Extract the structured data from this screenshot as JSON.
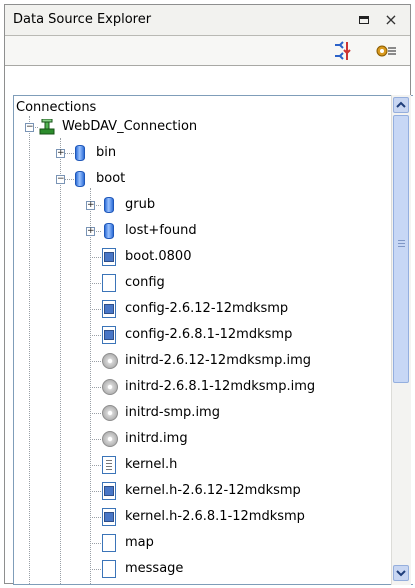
{
  "window": {
    "title": "Data Source Explorer",
    "maximize_symbol": "□",
    "close_symbol": "×"
  },
  "toolbar": {
    "collapse_icon": "collapse-all-icon",
    "menu_icon": "view-menu-icon"
  },
  "tree": {
    "root_label": "Connections",
    "connection_label": "WebDAV_Connection",
    "folders": [
      {
        "label": "bin",
        "icon": "database-icon"
      },
      {
        "label": "boot",
        "icon": "database-icon"
      },
      {
        "label": "grub",
        "icon": "database-icon"
      },
      {
        "label": "lost+found",
        "icon": "database-icon"
      }
    ],
    "files": [
      {
        "label": "boot.0800",
        "icon": "window-file-icon"
      },
      {
        "label": "config",
        "icon": "blank-file-icon"
      },
      {
        "label": "config-2.6.12-12mdksmp",
        "icon": "window-file-icon"
      },
      {
        "label": "config-2.6.8.1-12mdksmp",
        "icon": "window-file-icon"
      },
      {
        "label": "initrd-2.6.12-12mdksmp.img",
        "icon": "disk-image-icon"
      },
      {
        "label": "initrd-2.6.8.1-12mdksmp.img",
        "icon": "disk-image-icon"
      },
      {
        "label": "initrd-smp.img",
        "icon": "disk-image-icon"
      },
      {
        "label": "initrd.img",
        "icon": "disk-image-icon"
      },
      {
        "label": "kernel.h",
        "icon": "text-file-icon"
      },
      {
        "label": "kernel.h-2.6.12-12mdksmp",
        "icon": "window-file-icon"
      },
      {
        "label": "kernel.h-2.6.8.1-12mdksmp",
        "icon": "window-file-icon"
      },
      {
        "label": "map",
        "icon": "blank-file-icon"
      },
      {
        "label": "message",
        "icon": "blank-file-icon"
      }
    ],
    "expand_symbol": "+",
    "collapse_symbol": "−"
  },
  "scrollbar": {
    "up_symbol": "▲",
    "down_symbol": "▼"
  },
  "colors": {
    "title_bg": "#f2f2ef",
    "toolbar_bg": "#f7f7f5",
    "tree_border": "#7f9db9",
    "scroll_thumb": "#c7d7f5"
  }
}
